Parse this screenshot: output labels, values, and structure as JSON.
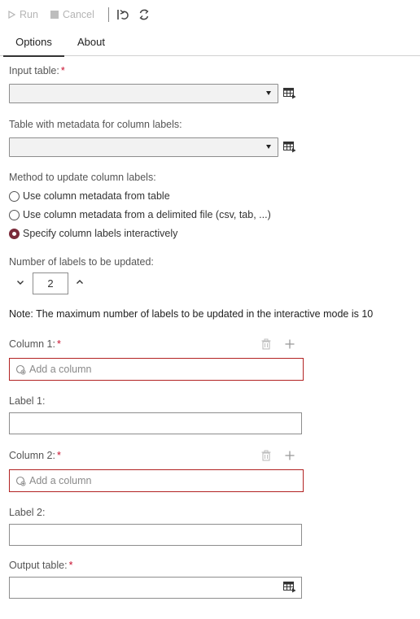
{
  "toolbar": {
    "run_label": "Run",
    "cancel_label": "Cancel"
  },
  "tabs": [
    {
      "label": "Options",
      "active": true
    },
    {
      "label": "About",
      "active": false
    }
  ],
  "input_table": {
    "label": "Input table:",
    "required_mark": "*",
    "value": ""
  },
  "metadata_table": {
    "label": "Table with metadata for column labels:",
    "value": ""
  },
  "method": {
    "label": "Method to update column labels:",
    "options": [
      {
        "label": "Use column metadata from table",
        "selected": false
      },
      {
        "label": "Use column metadata from a delimited file (csv, tab, ...)",
        "selected": false
      },
      {
        "label": "Specify column labels interactively",
        "selected": true
      }
    ]
  },
  "num_labels": {
    "label": "Number of labels to be updated:",
    "value": "2"
  },
  "note": "Note: The maximum number of labels to be updated in the interactive mode is 10",
  "columns": [
    {
      "column_label": "Column 1:",
      "required_mark": "*",
      "placeholder": "Add a column",
      "label_label": "Label 1:",
      "label_value": ""
    },
    {
      "column_label": "Column 2:",
      "required_mark": "*",
      "placeholder": "Add a column",
      "label_label": "Label 2:",
      "label_value": ""
    }
  ],
  "output_table": {
    "label": "Output table:",
    "required_mark": "*",
    "value": ""
  },
  "colors": {
    "accent_radio": "#7a2a3a",
    "required": "#c8102e",
    "error_border": "#b22222"
  }
}
